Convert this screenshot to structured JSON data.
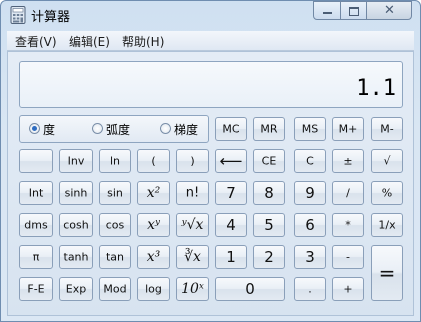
{
  "window": {
    "title": "计算器",
    "close_glyph": "✕"
  },
  "menu": [
    "查看(V)",
    "编辑(E)",
    "帮助(H)"
  ],
  "display": {
    "value": "1.1"
  },
  "angle_units": [
    {
      "label": "度",
      "selected": true
    },
    {
      "label": "弧度",
      "selected": false
    },
    {
      "label": "梯度",
      "selected": false
    }
  ],
  "memory_keys": [
    "MC",
    "MR",
    "MS",
    "M+",
    "M-"
  ],
  "keys": {
    "blank": "",
    "inv": "Inv",
    "ln": "ln",
    "lparen": "(",
    "rparen": ")",
    "backspace": "⟵",
    "ce": "CE",
    "c": "C",
    "plusminus": "±",
    "sqrt": "√",
    "int": "Int",
    "sinh": "sinh",
    "sin": "sin",
    "square": "x²",
    "factorial": "n!",
    "seven": "7",
    "eight": "8",
    "nine": "9",
    "divide": "/",
    "percent": "%",
    "dms": "dms",
    "cosh": "cosh",
    "cos": "cos",
    "power": "xʸ",
    "yroot": "ʸ√x",
    "four": "4",
    "five": "5",
    "six": "6",
    "multiply": "*",
    "reciprocal": "1/x",
    "pi": "π",
    "tanh": "tanh",
    "tan": "tan",
    "cube": "x³",
    "cuberoot": "∛x",
    "one": "1",
    "two": "2",
    "three": "3",
    "minus": "-",
    "equals": "=",
    "fe": "F-E",
    "exp": "Exp",
    "mod": "Mod",
    "log": "log",
    "tenpow": "10ˣ",
    "zero": "0",
    "decimal": ".",
    "plus": "+"
  }
}
